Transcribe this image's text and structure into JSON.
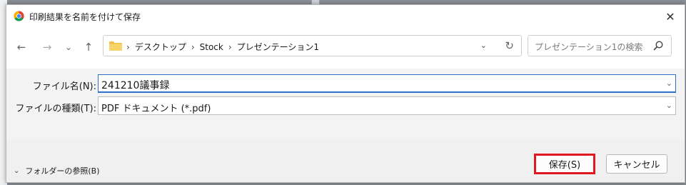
{
  "window": {
    "title": "印刷結果を名前を付けて保存",
    "close_glyph": "✕"
  },
  "nav": {
    "back_glyph": "←",
    "forward_glyph": "→",
    "recent_glyph": "⌄",
    "up_glyph": "↑",
    "breadcrumbs": [
      "デスクトップ",
      "Stock",
      "プレゼンテーション1"
    ],
    "separator": "›",
    "dropdown_glyph": "⌄",
    "refresh_glyph": "↻"
  },
  "search": {
    "placeholder": "プレゼンテーション1の検索"
  },
  "form": {
    "filename_label": "ファイル名(N):",
    "filename_value": "241210議事録",
    "filetype_label": "ファイルの種類(T):",
    "filetype_value": "PDF ドキュメント (*.pdf)",
    "dropdown_glyph": "⌄"
  },
  "footer": {
    "browse_folders_label": "フォルダーの参照(B)",
    "chevron_glyph": "⌄",
    "save_label": "保存(S)",
    "cancel_label": "キャンセル"
  },
  "colors": {
    "accent": "#2e71c7",
    "highlight_border": "#e0191f",
    "folder": "#f0c24b"
  },
  "icons": {
    "title": "chrome-icon",
    "folder": "folder-icon",
    "search": "search-icon"
  }
}
